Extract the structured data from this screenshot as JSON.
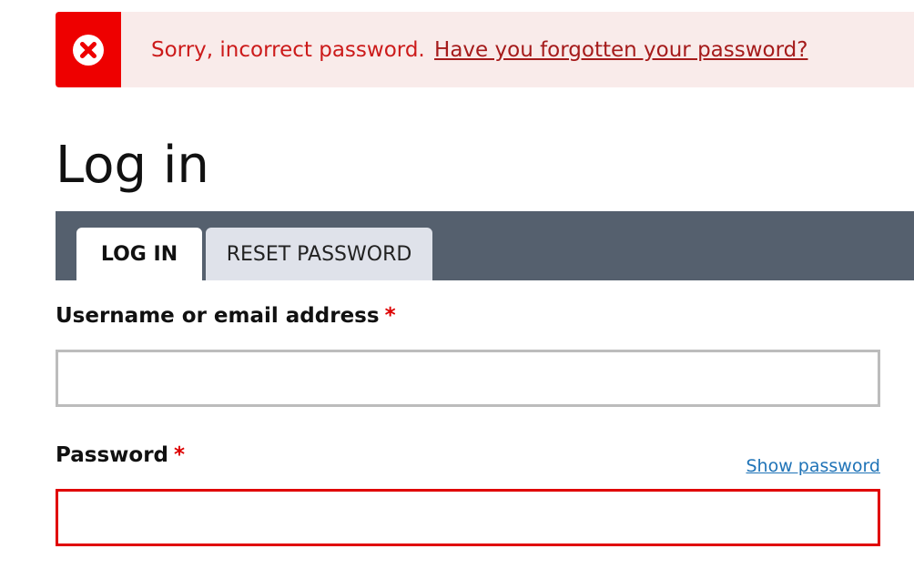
{
  "alert": {
    "icon": "error-x-icon",
    "message": "Sorry, incorrect password.",
    "link_text": "Have you forgotten your password?",
    "accent_color": "#ee0000"
  },
  "page": {
    "title": "Log in"
  },
  "tabs": [
    {
      "label": "LOG IN",
      "active": true
    },
    {
      "label": "RESET PASSWORD",
      "active": false
    }
  ],
  "form": {
    "username": {
      "label": "Username or email address",
      "required_marker": "*",
      "value": ""
    },
    "password": {
      "label": "Password",
      "required_marker": "*",
      "value": "",
      "show_password_label": "Show password",
      "error": true
    }
  },
  "colors": {
    "tab_bar": "#55606e",
    "error_border": "#e00000",
    "link": "#1f73b7"
  }
}
